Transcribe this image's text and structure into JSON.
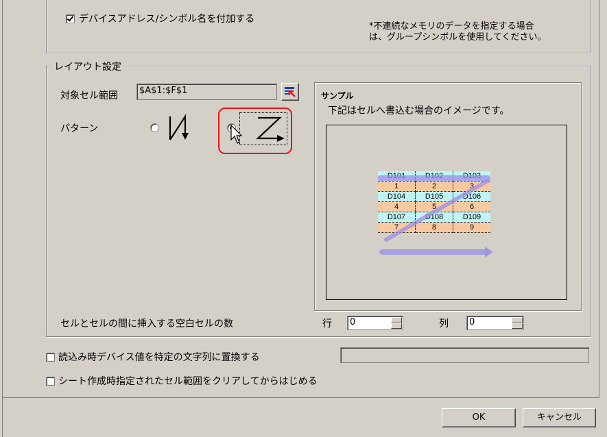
{
  "top": {
    "device_address_label": "デバイスアドレス/シンボル名を付加する",
    "note_line1": "*不連続なメモリのデータを指定する場合",
    "note_line2": "は、グループシンボルを使用してください。"
  },
  "layout": {
    "group_title": "レイアウト設定",
    "range_label": "対象セル範囲",
    "range_value": "$A$1:$F$1",
    "pattern_label": "パターン",
    "pattern_selected": 2,
    "gap_label": "セルとセルの間に挿入する空白セルの数",
    "row_label": "行",
    "row_value": "0",
    "col_label": "列",
    "col_value": "0"
  },
  "sample": {
    "title": "サンプル",
    "description": "下記はセルへ書込む場合のイメージです。",
    "rows": [
      [
        "D101",
        "D102",
        "D103"
      ],
      [
        "1",
        "2",
        "3"
      ],
      [
        "D104",
        "D105",
        "D106"
      ],
      [
        "4",
        "5",
        "6"
      ],
      [
        "D107",
        "D108",
        "D109"
      ],
      [
        "7",
        "8",
        "9"
      ]
    ]
  },
  "options": {
    "replace_label": "読込み時デバイス値を特定の文字列に置換する",
    "replace_value": "",
    "clear_label": "シート作成時指定されたセル範囲をクリアしてからはじめる"
  },
  "buttons": {
    "ok": "OK",
    "cancel": "キャンセル"
  },
  "colors": {
    "highlight": "#e8141c",
    "label_row": "#bff3f5",
    "value_row": "#f6c9a0",
    "arrow": "#9b8fe6"
  }
}
